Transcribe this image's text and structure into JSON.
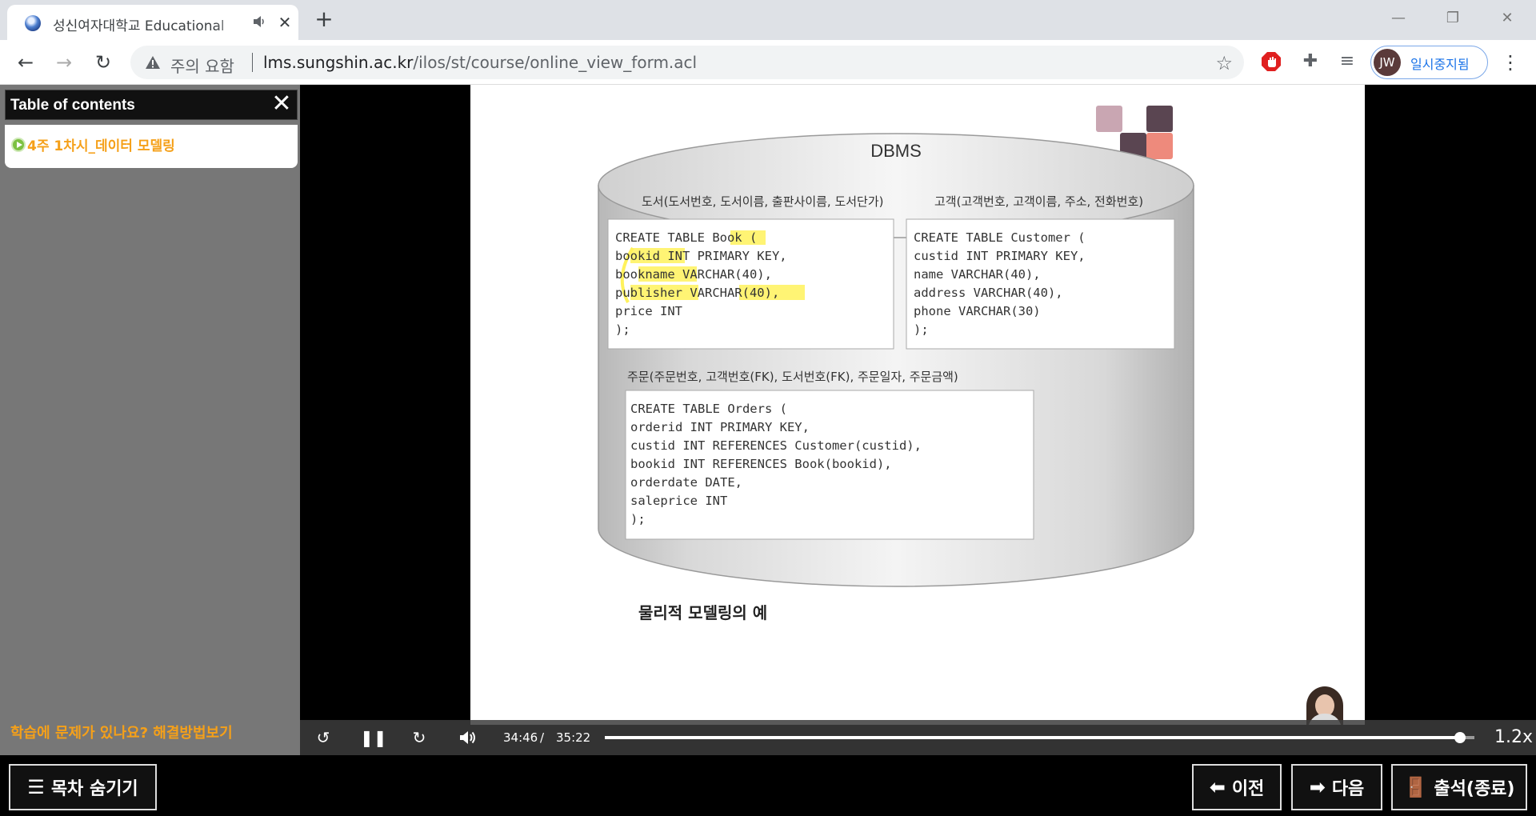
{
  "browser": {
    "tab_title": "성신여자대학교 Educational",
    "tab_close": "✕",
    "new_tab": "+",
    "address_warning": "주의 요함",
    "url_host": "lms.sungshin.ac.kr",
    "url_path": "/ilos/st/course/online_view_form.acl",
    "profile_initials": "JW",
    "profile_status": "일시중지됨"
  },
  "sidebar": {
    "title": "Table of contents",
    "close_glyph": "✕",
    "items": [
      {
        "label": "4주 1차시_데이터 모델링"
      }
    ],
    "help_link": "학습에 문제가 있나요? 해결방법보기"
  },
  "slide": {
    "dbms_label": "DBMS",
    "book_schema": "도서(도서번호, 도서이름, 출판사이름, 도서단가)",
    "customer_schema": "고객(고객번호, 고객이름, 주소, 전화번호)",
    "orders_schema": "주문(주문번호, 고객번호(FK), 도서번호(FK), 주문일자, 주문금액)",
    "book_sql": [
      "CREATE TABLE Book (",
      "  bookid      INT PRIMARY KEY,",
      "  bookname    VARCHAR(40),",
      "  publisher   VARCHAR(40),",
      "  price       INT",
      ");"
    ],
    "customer_sql": [
      "CREATE TABLE  Customer (",
      "  custid    INT PRIMARY KEY,",
      "  name      VARCHAR(40),",
      "  address   VARCHAR(40),",
      "  phone     VARCHAR(30)",
      ");"
    ],
    "orders_sql": [
      "CREATE TABLE Orders (",
      "  orderid   INT  PRIMARY KEY,",
      "  custid    INT  REFERENCES Customer(custid),",
      "  bookid    INT  REFERENCES Book(bookid),",
      "  orderdate DATE,",
      "  saleprice INT",
      ");"
    ],
    "caption": "물리적 모델링의 예",
    "deco_colors": [
      "#c9a6b2",
      "#5a4551",
      "#5a4551",
      "#ee8a7c"
    ],
    "highlight_color": "#fff25c"
  },
  "player": {
    "current_time": "34:46",
    "separator": "/",
    "duration": "35:22",
    "progress": 0.983,
    "speed": "1.2x"
  },
  "bottom": {
    "toc_toggle": "목차 숨기기",
    "prev": "이전",
    "next": "다음",
    "attendance": "출석(종료)"
  }
}
